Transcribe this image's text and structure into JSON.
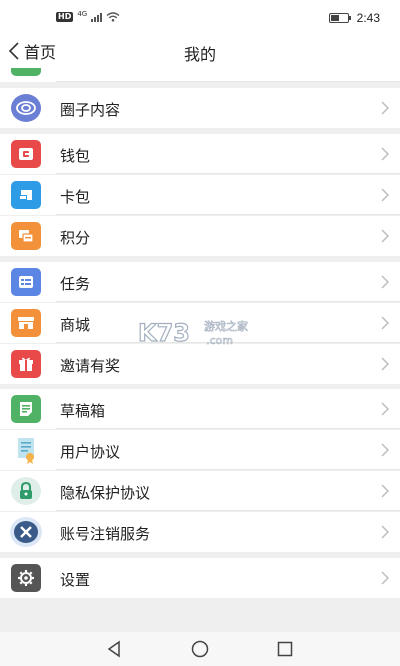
{
  "status_bar": {
    "hd": "HD",
    "network": "4G",
    "time": "2:43"
  },
  "header": {
    "back_label": "首页",
    "title": "我的"
  },
  "menu": [
    {
      "label": "圈子内容",
      "icon": "circle-content-icon",
      "color": "#6b7fd4"
    },
    {
      "label": "钱包",
      "icon": "wallet-icon",
      "color": "#e84a4a"
    },
    {
      "label": "卡包",
      "icon": "card-icon",
      "color": "#2e9be6"
    },
    {
      "label": "积分",
      "icon": "points-icon",
      "color": "#f3903a"
    },
    {
      "label": "任务",
      "icon": "task-icon",
      "color": "#5b86e3"
    },
    {
      "label": "商城",
      "icon": "mall-icon",
      "color": "#f3903a"
    },
    {
      "label": "邀请有奖",
      "icon": "gift-icon",
      "color": "#e84a4a"
    },
    {
      "label": "草稿箱",
      "icon": "draft-icon",
      "color": "#4fb265"
    },
    {
      "label": "用户协议",
      "icon": "user-agreement-icon",
      "color": "#7fc5df"
    },
    {
      "label": "隐私保护协议",
      "icon": "privacy-lock-icon",
      "color": "#2f9b6b"
    },
    {
      "label": "账号注销服务",
      "icon": "account-cancel-icon",
      "color": "#3a5a8a"
    },
    {
      "label": "设置",
      "icon": "settings-icon",
      "color": "#555555"
    }
  ],
  "watermark": {
    "logo_text": "K73",
    "site_name": "游戏之家",
    "domain": ".com"
  },
  "system_nav": {
    "back": "back-triangle-icon",
    "home": "home-circle-icon",
    "recents": "recents-square-icon"
  }
}
